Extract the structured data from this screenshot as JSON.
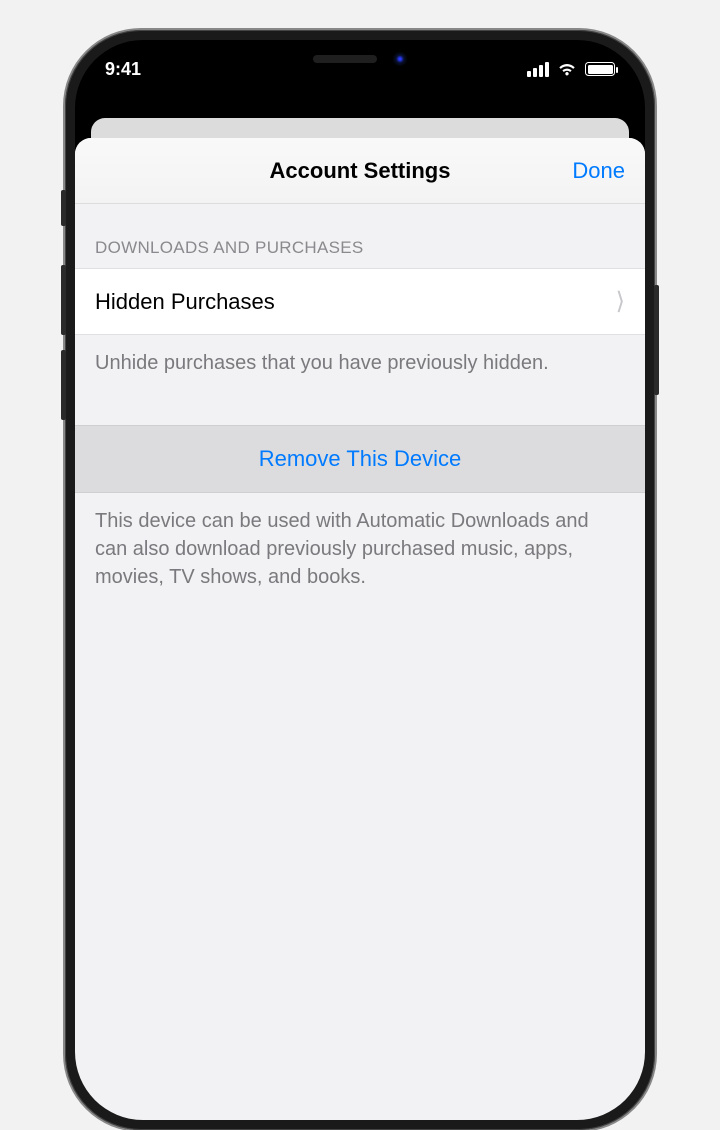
{
  "statusBar": {
    "time": "9:41"
  },
  "sheet": {
    "title": "Account Settings",
    "done": "Done"
  },
  "section": {
    "header": "Downloads and Purchases",
    "hiddenPurchases": {
      "label": "Hidden Purchases"
    },
    "hiddenFooter": "Unhide purchases that you have previously hidden.",
    "removeDevice": {
      "label": "Remove This Device"
    },
    "removeFooter": "This device can be used with Automatic Downloads and can also download previously purchased music, apps, movies, TV shows, and books."
  }
}
